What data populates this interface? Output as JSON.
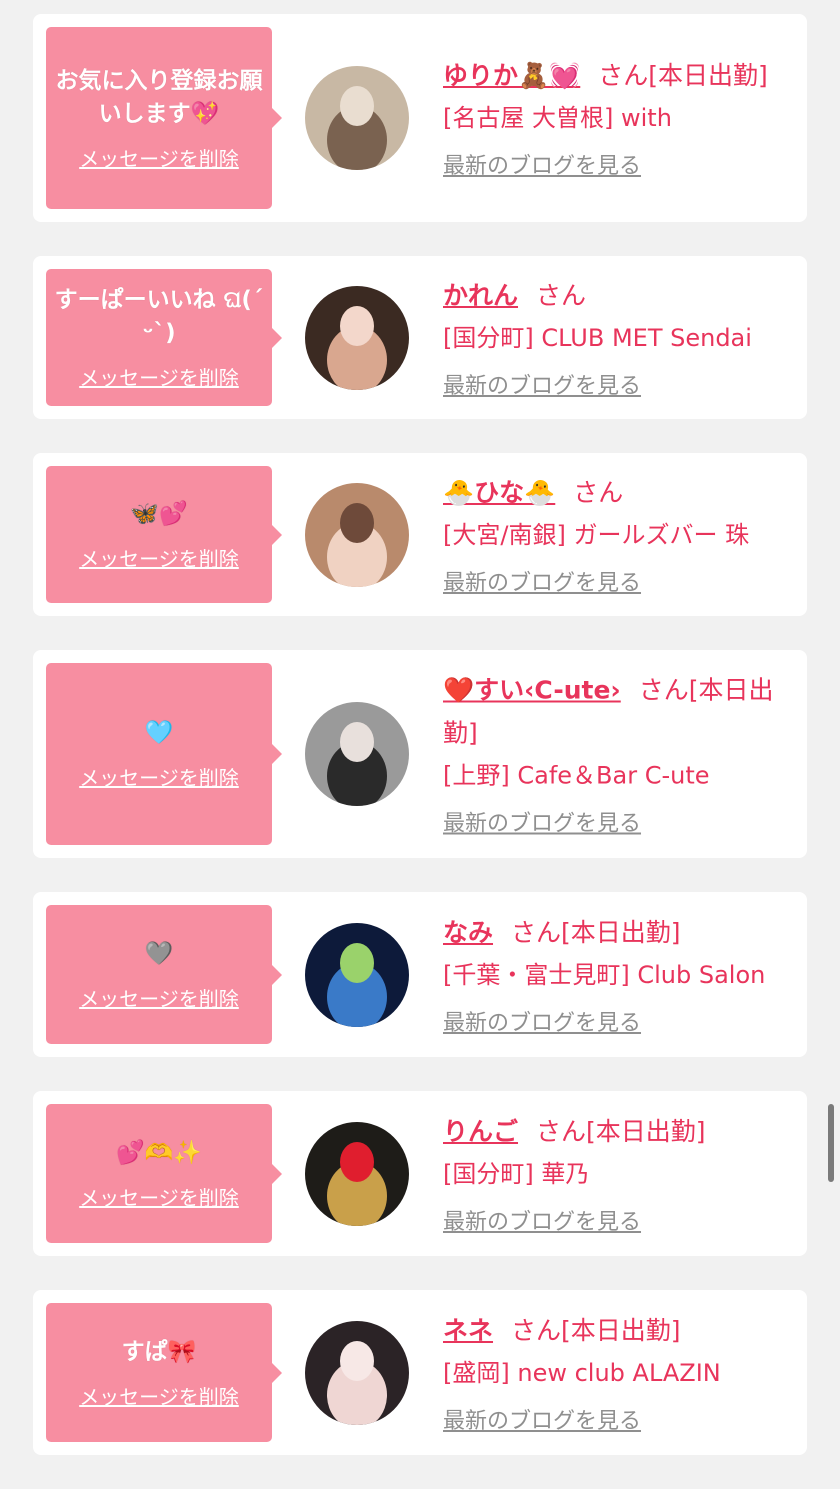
{
  "items": [
    {
      "message": "お気に入り登録お願いします💖",
      "delete_label": "メッセージを削除",
      "name": "ゆりか🧸💓",
      "san": "さん[本日出勤]",
      "shop": "[名古屋 大曽根] with",
      "blog_label": "最新のブログを見る",
      "avatar_colors": [
        "#c8b8a4",
        "#7a6250",
        "#e9ddd0"
      ]
    },
    {
      "message": "すーぱーいいね ଘ(ˊᵕˋ)",
      "delete_label": "メッセージを削除",
      "name": "かれん",
      "san": "さん",
      "shop": "[国分町] CLUB MET Sendai",
      "blog_label": "最新のブログを見る",
      "avatar_colors": [
        "#3b2a22",
        "#d9a78f",
        "#f3d7cb"
      ]
    },
    {
      "message": "🦋💕",
      "delete_label": "メッセージを削除",
      "name": "🐣ひな🐣",
      "san": "さん",
      "shop": "[大宮/南銀] ガールズバー 珠",
      "blog_label": "最新のブログを見る",
      "avatar_colors": [
        "#b98a6c",
        "#f0d2c2",
        "#6e4a3a"
      ]
    },
    {
      "message": "🩵",
      "delete_label": "メッセージを削除",
      "name": "❤️すい‹C-ute›",
      "san": "さん[本日出勤]",
      "shop": "[上野] Cafe＆Bar C-ute",
      "blog_label": "最新のブログを見る",
      "avatar_colors": [
        "#9a9a9a",
        "#2a2a2a",
        "#e8e0dc"
      ]
    },
    {
      "message": "🩶",
      "delete_label": "メッセージを削除",
      "name": "なみ",
      "san": "さん[本日出勤]",
      "shop": "[千葉・富士見町] Club Salon",
      "blog_label": "最新のブログを見る",
      "avatar_colors": [
        "#0d1a3a",
        "#3a7ac8",
        "#9ad26b"
      ]
    },
    {
      "message": "💕🫶✨",
      "delete_label": "メッセージを削除",
      "name": "りんご",
      "san": "さん[本日出勤]",
      "shop": "[国分町] 華乃",
      "blog_label": "最新のブログを見る",
      "avatar_colors": [
        "#1e1c18",
        "#c9a04a",
        "#e01e2e"
      ]
    },
    {
      "message": "すぱ🎀",
      "delete_label": "メッセージを削除",
      "name": "ネネ",
      "san": "さん[本日出勤]",
      "shop": "[盛岡] new club ALAZIN",
      "blog_label": "最新のブログを見る",
      "avatar_colors": [
        "#2b2326",
        "#efd6d3",
        "#f7e8e6"
      ]
    }
  ]
}
